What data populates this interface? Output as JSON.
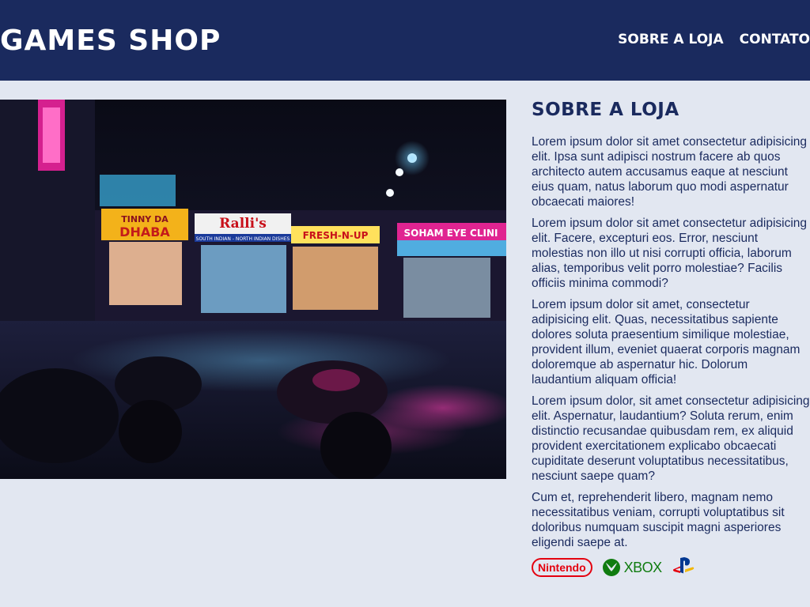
{
  "header": {
    "brand": "GAMES SHOP",
    "nav": [
      {
        "label": "SOBRE A LOJA"
      },
      {
        "label": "CONTATO"
      }
    ]
  },
  "hero": {
    "signs": [
      "TINNY DA",
      "DHABA",
      "Ralli's",
      "SOUTH INDIAN - NORTH INDIAN DISHES",
      "FRESH-N-UP",
      "SOHAM EYE CLINI"
    ]
  },
  "about": {
    "title": "SOBRE A LOJA",
    "paragraphs": [
      "Lorem ipsum dolor sit amet consectetur adipisicing elit. Ipsa sunt adipisci nostrum facere ab quos architecto autem accusamus eaque at nesciunt eius quam, natus laborum quo modi aspernatur obcaecati maiores!",
      "Lorem ipsum dolor sit amet consectetur adipisicing elit. Facere, excepturi eos. Error, nesciunt molestias non illo ut nisi corrupti officia, laborum alias, temporibus velit porro molestiae? Facilis officiis minima commodi?",
      "Lorem ipsum dolor sit amet, consectetur adipisicing elit. Quas, necessitatibus sapiente dolores soluta praesentium similique molestiae, provident illum, eveniet quaerat corporis magnam doloremque ab aspernatur hic. Dolorum laudantium aliquam officia!",
      "Lorem ipsum dolor, sit amet consectetur adipisicing elit. Aspernatur, laudantium? Soluta rerum, enim distinctio recusandae quibusdam rem, ex aliquid provident exercitationem explicabo obcaecati cupiditate deserunt voluptatibus necessitatibus, nesciunt saepe quam?",
      "Cum et, reprehenderit libero, magnam nemo necessitatibus veniam, corrupti voluptatibus sit doloribus numquam suscipit magni asperiores eligendi saepe at."
    ],
    "logos": {
      "nintendo": "Nintendo",
      "xbox": "XBOX"
    }
  },
  "colors": {
    "header_bg": "#1a2a5e",
    "page_bg": "#e2e7f1",
    "text": "#1a2a5e",
    "nintendo_red": "#e4000f",
    "xbox_green": "#107c10",
    "playstation_blue": "#003791"
  }
}
